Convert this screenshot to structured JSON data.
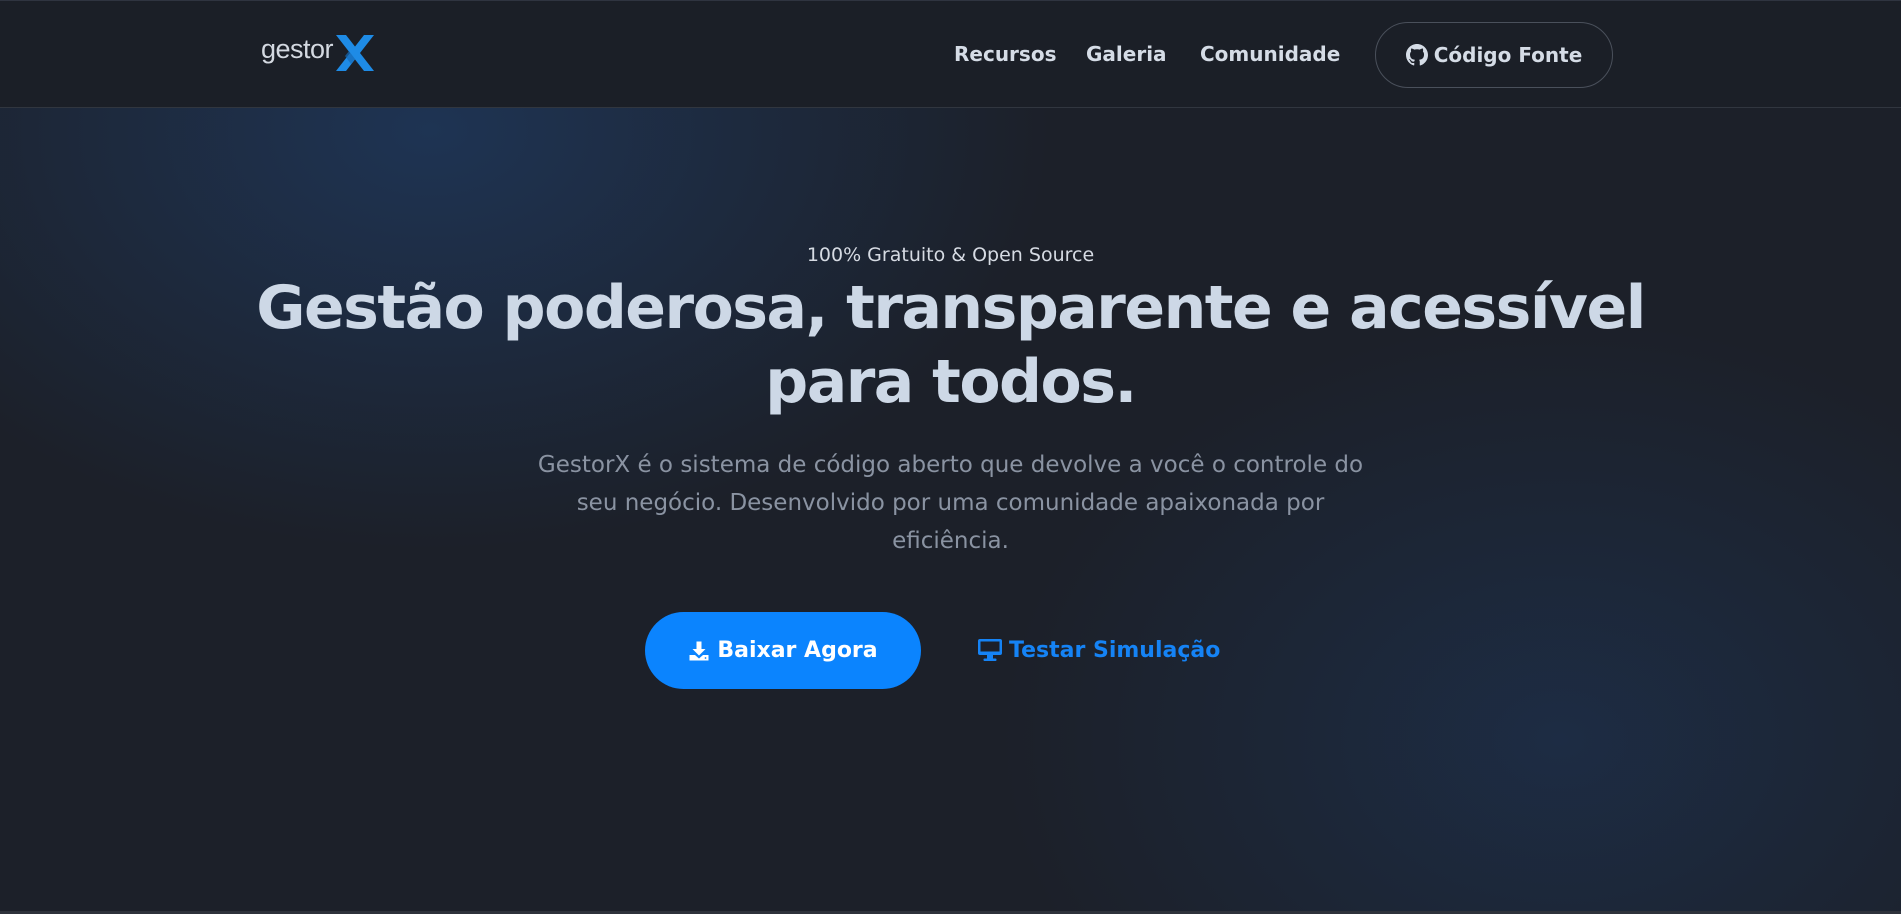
{
  "header": {
    "logo": {
      "text": "gestor",
      "mark": "X",
      "mark_color": "#1e8be6"
    },
    "nav": [
      {
        "label": "Recursos"
      },
      {
        "label": "Galeria"
      },
      {
        "label": "Comunidade"
      }
    ],
    "source_button": {
      "label": "Código Fonte",
      "icon": "github-icon"
    }
  },
  "hero": {
    "eyebrow": "100% Gratuito & Open Source",
    "headline_line1": "Gestão poderosa, transparente e acessível",
    "headline_line2": "para todos.",
    "subtitle_line1": "GestorX é o sistema de código aberto que devolve a você o controle do",
    "subtitle_line2": "seu negócio. Desenvolvido por uma comunidade apaixonada por",
    "subtitle_line3": "eficiência.",
    "primary_button": {
      "label": "Baixar Agora",
      "icon": "download-icon"
    },
    "secondary_button": {
      "label": "Testar Simulação",
      "icon": "monitor-icon"
    }
  },
  "colors": {
    "accent": "#0b84fe",
    "background": "#1c2029",
    "header_background": "#1b1f27",
    "headline": "#cdd8e6",
    "muted_text": "#8a93a2"
  }
}
